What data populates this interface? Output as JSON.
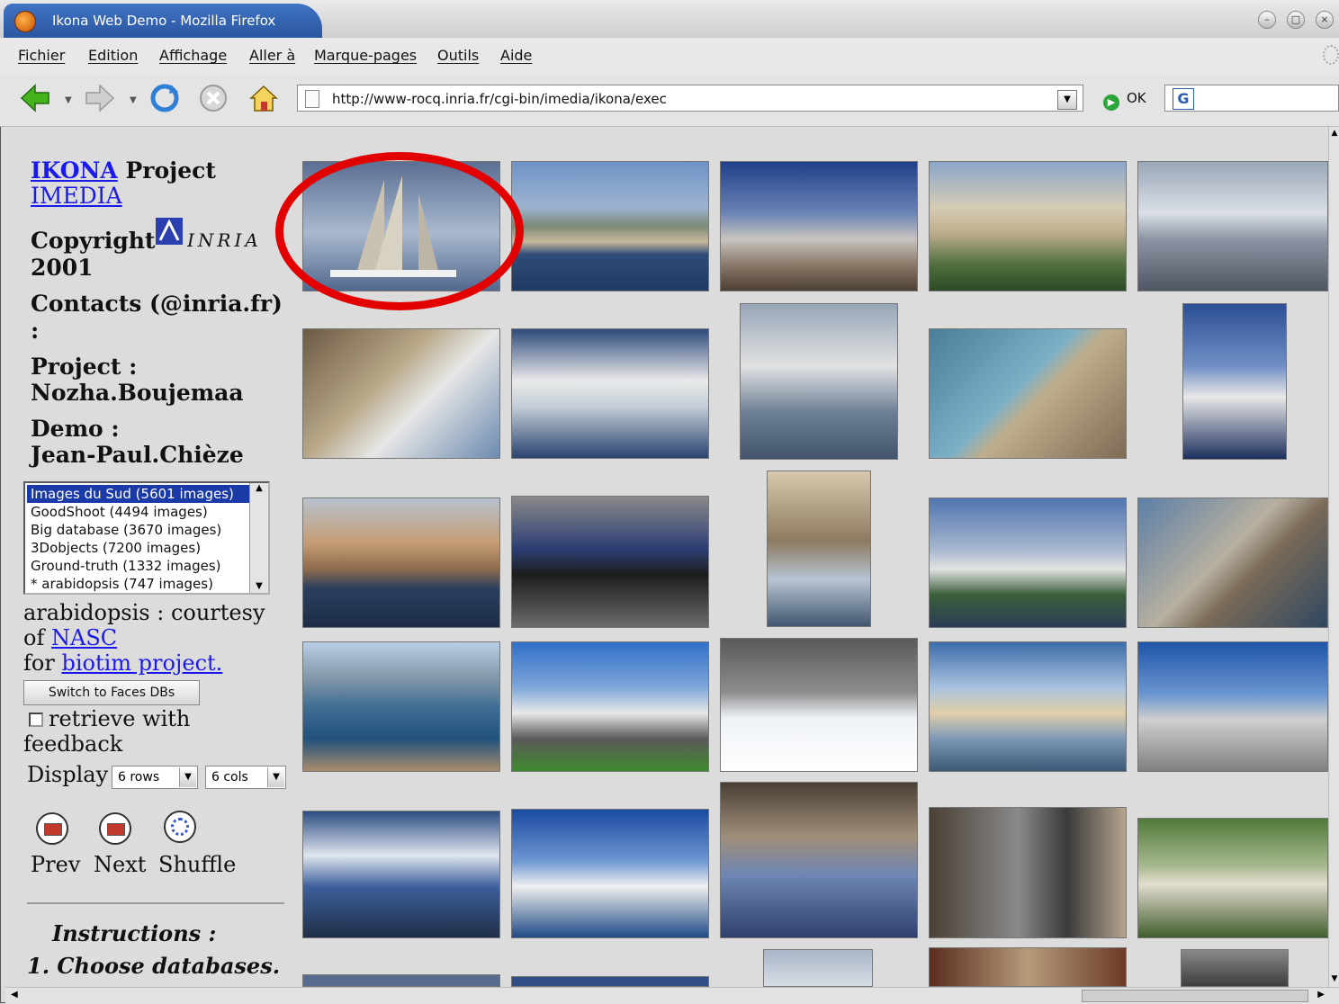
{
  "window": {
    "title": "Ikona Web Demo - Mozilla Firefox"
  },
  "menubar": {
    "items": [
      "Fichier",
      "Edition",
      "Affichage",
      "Aller à",
      "Marque-pages",
      "Outils",
      "Aide"
    ]
  },
  "toolbar": {
    "url": "http://www-rocq.inria.fr/cgi-bin/imedia/ikona/exec",
    "go_label": "OK",
    "search_logo": "G"
  },
  "sidebar": {
    "project_link": "IKONA",
    "project_text": "Project",
    "imedia_link": "IMEDIA",
    "copyright_label": "Copyright",
    "inria_text": "INRIA",
    "year": "2001",
    "contacts_label": "Contacts (@inria.fr)",
    "contacts_colon": ":",
    "project_label": "Project :",
    "project_person": "Nozha.Boujemaa",
    "demo_label": "Demo :",
    "demo_person": "Jean-Paul.Chièze",
    "databases": [
      "Images du Sud (5601 images)",
      "GoodShoot (4494 images)",
      "Big database (3670 images)",
      "3Dobjects (7200 images)",
      "Ground-truth (1332 images)",
      "* arabidopsis (747 images)"
    ],
    "courtesy_line": "arabidopsis : courtesy",
    "of_text": "of",
    "nasc_link": "NASC",
    "for_text": "for",
    "biotim_link": "biotim project.",
    "switch_button": "Switch to Faces DBs",
    "feedback_line1": "retrieve with",
    "feedback_line2": "feedback",
    "display_label": "Display",
    "rows_value": "6 rows",
    "cols_value": "6 cols",
    "prev_label": "Prev",
    "next_label": "Next",
    "shuffle_label": "Shuffle",
    "instructions_title": "Instructions :",
    "instructions_step1": "1. Choose databases."
  },
  "colors": {
    "link": "#1a1aee",
    "highlight": "#e30000",
    "selection": "#1a3aa8"
  }
}
